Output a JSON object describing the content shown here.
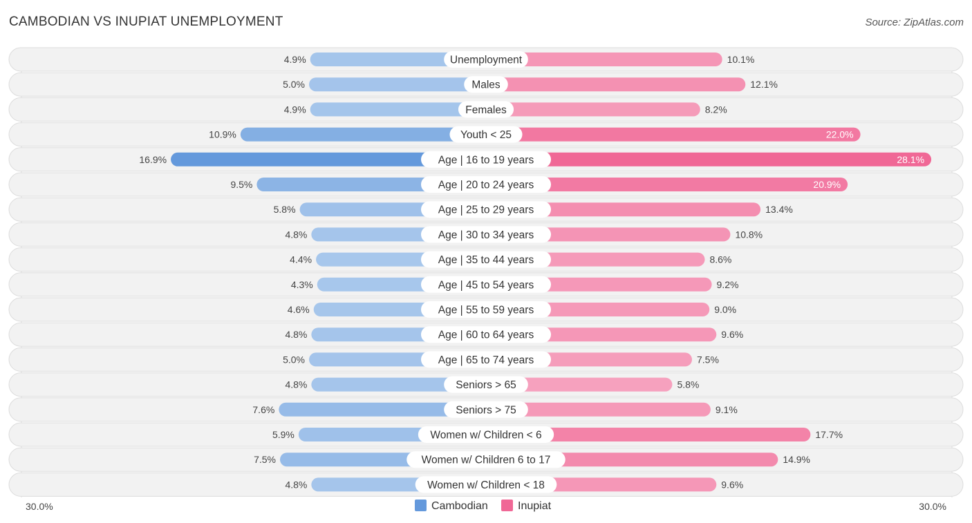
{
  "header": {
    "title": "CAMBODIAN VS INUPIAT UNEMPLOYMENT",
    "source": "Source: ZipAtlas.com"
  },
  "colors": {
    "cambodian_strong": "#6499dc",
    "cambodian_light": "#a9c8ec",
    "inupiat_strong": "#f06896",
    "inupiat_light": "#f6a3bf"
  },
  "chart_data": {
    "type": "bar",
    "orientation": "horizontal-diverging",
    "title": "CAMBODIAN VS INUPIAT UNEMPLOYMENT",
    "categories": [
      "Unemployment",
      "Males",
      "Females",
      "Youth < 25",
      "Age | 16 to 19 years",
      "Age | 20 to 24 years",
      "Age | 25 to 29 years",
      "Age | 30 to 34 years",
      "Age | 35 to 44 years",
      "Age | 45 to 54 years",
      "Age | 55 to 59 years",
      "Age | 60 to 64 years",
      "Age | 65 to 74 years",
      "Seniors > 65",
      "Seniors > 75",
      "Women w/ Children < 6",
      "Women w/ Children 6 to 17",
      "Women w/ Children < 18"
    ],
    "series": [
      {
        "name": "Cambodian",
        "side": "left",
        "values": [
          4.9,
          5.0,
          4.9,
          10.9,
          16.9,
          9.5,
          5.8,
          4.8,
          4.4,
          4.3,
          4.6,
          4.8,
          5.0,
          4.8,
          7.6,
          5.9,
          7.5,
          4.8
        ]
      },
      {
        "name": "Inupiat",
        "side": "right",
        "values": [
          10.1,
          12.1,
          8.2,
          22.0,
          28.1,
          20.9,
          13.4,
          10.8,
          8.6,
          9.2,
          9.0,
          9.6,
          7.5,
          5.8,
          9.1,
          17.7,
          14.9,
          9.6
        ]
      }
    ],
    "value_labels_left": [
      "4.9%",
      "5.0%",
      "4.9%",
      "10.9%",
      "16.9%",
      "9.5%",
      "5.8%",
      "4.8%",
      "4.4%",
      "4.3%",
      "4.6%",
      "4.8%",
      "5.0%",
      "4.8%",
      "7.6%",
      "5.9%",
      "7.5%",
      "4.8%"
    ],
    "value_labels_right": [
      "10.1%",
      "12.1%",
      "8.2%",
      "22.0%",
      "28.1%",
      "20.9%",
      "13.4%",
      "10.8%",
      "8.6%",
      "9.2%",
      "9.0%",
      "9.6%",
      "7.5%",
      "5.8%",
      "9.1%",
      "17.7%",
      "14.9%",
      "9.6%"
    ],
    "axis": {
      "left_label": "30.0%",
      "right_label": "30.0%",
      "max": 30.0
    },
    "legend": {
      "position": "bottom-center",
      "items": [
        "Cambodian",
        "Inupiat"
      ]
    },
    "grid": false
  }
}
